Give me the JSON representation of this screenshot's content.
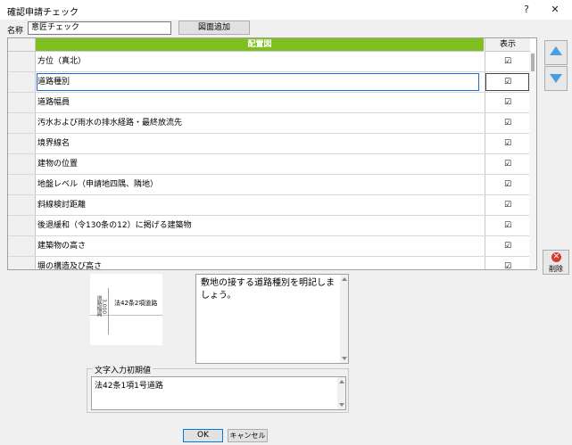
{
  "window": {
    "title": "確認申請チェック",
    "help": "?",
    "close": "✕"
  },
  "name_field": {
    "label": "名称",
    "value": "意匠チェック"
  },
  "add_button": "図面追加",
  "grid": {
    "col_name": "配置図",
    "col_show": "表示",
    "rows": [
      {
        "name": "方位（真北）",
        "check": "☑"
      },
      {
        "name": "道路種別",
        "check": "☑"
      },
      {
        "name": "道路幅員",
        "check": "☑"
      },
      {
        "name": "汚水および雨水の排水経路・最終放流先",
        "check": "☑"
      },
      {
        "name": "境界線名",
        "check": "☑"
      },
      {
        "name": "建物の位置",
        "check": "☑"
      },
      {
        "name": "地盤レベル（申請地四隅、隣地）",
        "check": "☑"
      },
      {
        "name": "斜線検討距離",
        "check": "☑"
      },
      {
        "name": "後退緩和（令130条の12）に掲げる建築物",
        "check": "☑"
      },
      {
        "name": "建築物の高さ",
        "check": "☑"
      },
      {
        "name": "塀の構造及び高さ",
        "check": "☑"
      }
    ]
  },
  "delete_button": "削除",
  "preview": {
    "road_label": "法42条2項道路",
    "width_label": "道路幅員",
    "width_value": "3,000"
  },
  "memo_text": "敷地の接する道路種別を明記しましょう。",
  "initial_value": {
    "legend": "文字入力初期値",
    "value": "法42条1項1号道路"
  },
  "ok_button": "OK",
  "cancel_button": "キャンセル"
}
